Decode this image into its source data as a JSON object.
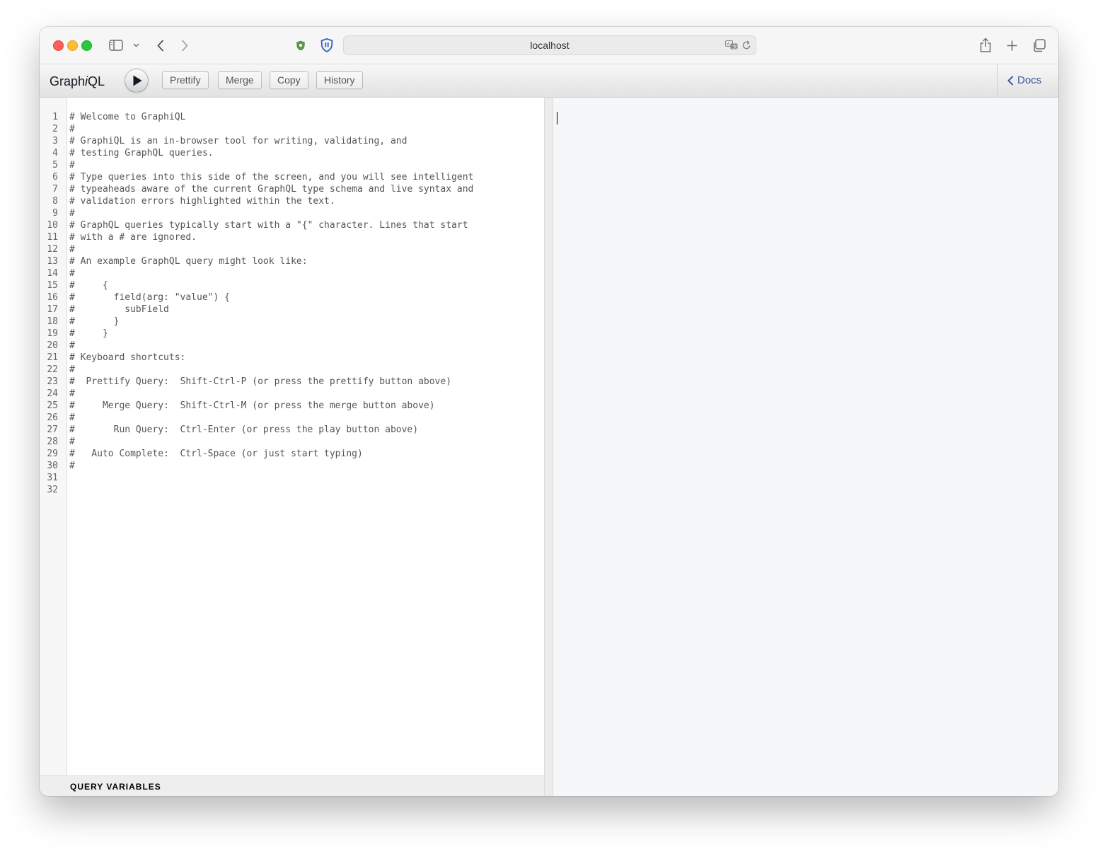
{
  "browser": {
    "address": "localhost"
  },
  "toolbar": {
    "title_prefix": "Graph",
    "title_italic": "i",
    "title_suffix": "QL",
    "buttons": [
      "Prettify",
      "Merge",
      "Copy",
      "History"
    ],
    "docs_label": "Docs"
  },
  "editor": {
    "line_numbers": "1\n2\n3\n4\n5\n6\n7\n8\n9\n10\n11\n12\n13\n14\n15\n16\n17\n18\n19\n20\n21\n22\n23\n24\n25\n26\n27\n28\n29\n30\n31\n32",
    "code": "# Welcome to GraphiQL\n#\n# GraphiQL is an in-browser tool for writing, validating, and\n# testing GraphQL queries.\n#\n# Type queries into this side of the screen, and you will see intelligent\n# typeaheads aware of the current GraphQL type schema and live syntax and\n# validation errors highlighted within the text.\n#\n# GraphQL queries typically start with a \"{\" character. Lines that start\n# with a # are ignored.\n#\n# An example GraphQL query might look like:\n#\n#     {\n#       field(arg: \"value\") {\n#         subField\n#       }\n#     }\n#\n# Keyboard shortcuts:\n#\n#  Prettify Query:  Shift-Ctrl-P (or press the prettify button above)\n#\n#     Merge Query:  Shift-Ctrl-M (or press the merge button above)\n#\n#       Run Query:  Ctrl-Enter (or press the play button above)\n#\n#   Auto Complete:  Ctrl-Space (or just start typing)\n#\n\n",
    "variables_title": "QUERY VARIABLES"
  }
}
